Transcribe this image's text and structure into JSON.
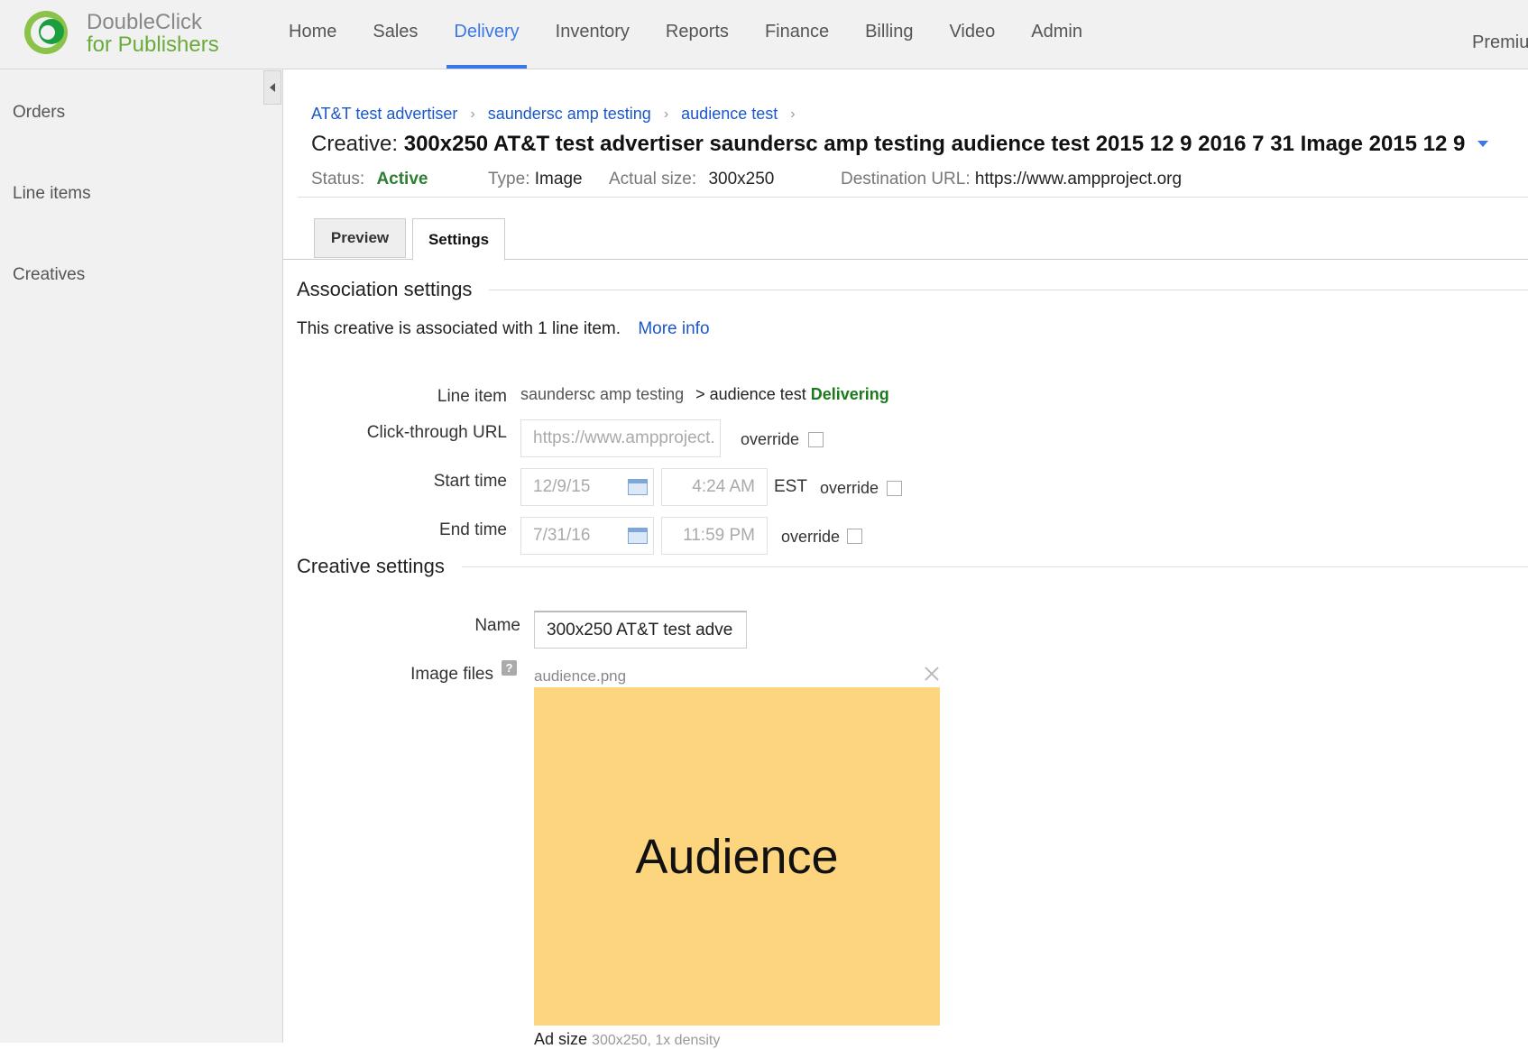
{
  "brand": {
    "line1": "DoubleClick",
    "line2": "for Publishers"
  },
  "nav": {
    "items": [
      {
        "label": "Home"
      },
      {
        "label": "Sales"
      },
      {
        "label": "Delivery"
      },
      {
        "label": "Inventory"
      },
      {
        "label": "Reports"
      },
      {
        "label": "Finance"
      },
      {
        "label": "Billing"
      },
      {
        "label": "Video"
      },
      {
        "label": "Admin"
      }
    ],
    "active": "Delivery",
    "account": "Premiu"
  },
  "sidebar": {
    "items": [
      {
        "label": "Orders"
      },
      {
        "label": "Line items"
      },
      {
        "label": "Creatives"
      }
    ]
  },
  "breadcrumb": [
    {
      "label": "AT&T test advertiser"
    },
    {
      "label": "saundersc amp testing"
    },
    {
      "label": "audience test"
    }
  ],
  "header": {
    "title_label": "Creative:",
    "title_value": "300x250 AT&T test advertiser saundersc amp testing audience test 2015 12 9 2016 7 31 Image 2015 12 9",
    "status_label": "Status:",
    "status_value": "Active",
    "type_label": "Type:",
    "type_value": "Image",
    "size_label": "Actual size:",
    "size_value": "300x250",
    "dest_label": "Destination URL:",
    "dest_value": "https://www.ampproject.org"
  },
  "tabs": {
    "preview": "Preview",
    "settings": "Settings"
  },
  "association": {
    "section_title": "Association settings",
    "text": "This creative is associated with 1 line item.",
    "more_info": "More info",
    "line_item_label": "Line item",
    "line_item_order": "saundersc amp testing",
    "line_item_name": "> audience test",
    "line_item_status": "Delivering",
    "click_url_label": "Click-through URL",
    "click_url_placeholder": "https://www.ampproject.",
    "start_label": "Start time",
    "start_date": "12/9/15",
    "start_time": "4:24 AM",
    "timezone": "EST",
    "end_label": "End time",
    "end_date": "7/31/16",
    "end_time": "11:59 PM",
    "override_label": "override"
  },
  "creative": {
    "section_title": "Creative settings",
    "name_label": "Name",
    "name_value": "300x250 AT&T test adve",
    "image_files_label": "Image files",
    "help": "?",
    "file_name": "audience.png",
    "image_text": "Audience",
    "ad_size_label": "Ad size",
    "ad_size_value": "300x250, 1x density"
  },
  "colors": {
    "accent": "#3b78e7",
    "status_active": "#2e7d32",
    "delivering": "#1b7a1b",
    "image_bg": "#fdd57e"
  }
}
